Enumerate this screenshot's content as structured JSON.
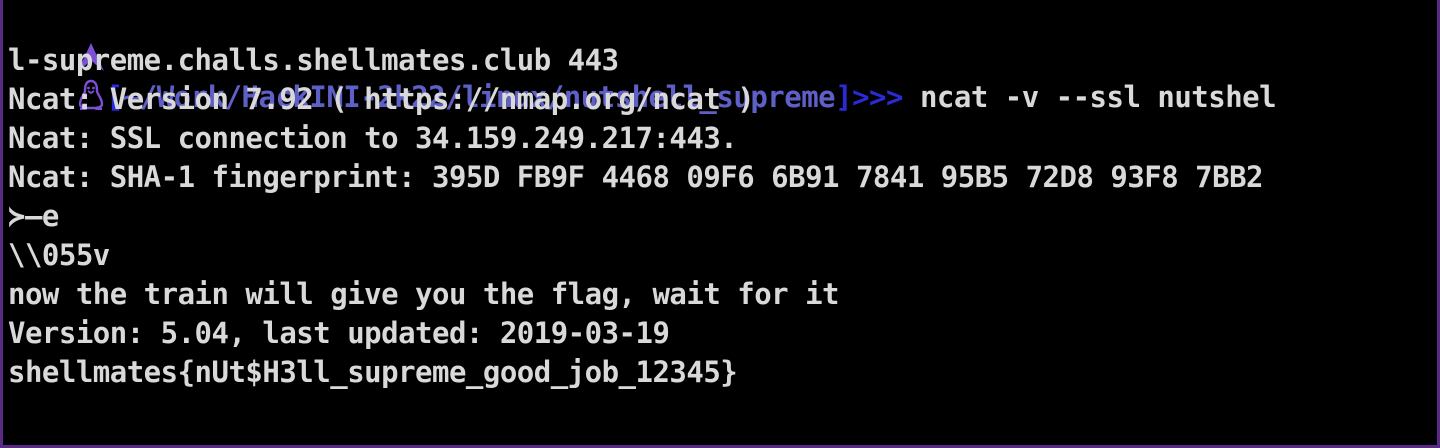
{
  "terminal": {
    "prompt": {
      "arch_icon": "arch-linux-icon",
      "tux_icon": "tux-penguin-icon",
      "open_bracket": "[",
      "path": "~/Work/HackINI-2k22/linux/nutshell_supreme",
      "close_bracket": "]",
      "prompt_symbol": ">>>",
      "command_part1": " ncat -v --ssl nutshel",
      "command_part2": "l-supreme.challs.shellmates.club 443"
    },
    "output": [
      "Ncat: Version 7.92 ( https://nmap.org/ncat )",
      "Ncat: SSL connection to 34.159.249.217:443.",
      "Ncat: SHA-1 fingerprint: 395D FB9F 4468 09F6 6B91 7841 95B5 72D8 93F8 7BB2",
      "≻—e",
      "\\\\055v",
      "now the train will give you the flag, wait for it",
      "Version: 5.04, last updated: 2019-03-19",
      "shellmates{nUt$H3ll_supreme_good_job_12345}"
    ]
  },
  "colors": {
    "background": "#000000",
    "frame": "#5b2a86",
    "text": "#d9d9d9",
    "arch_icon": "#7b4fd6",
    "bracket": "#2a2ad8",
    "path": "#5f5fc8"
  }
}
